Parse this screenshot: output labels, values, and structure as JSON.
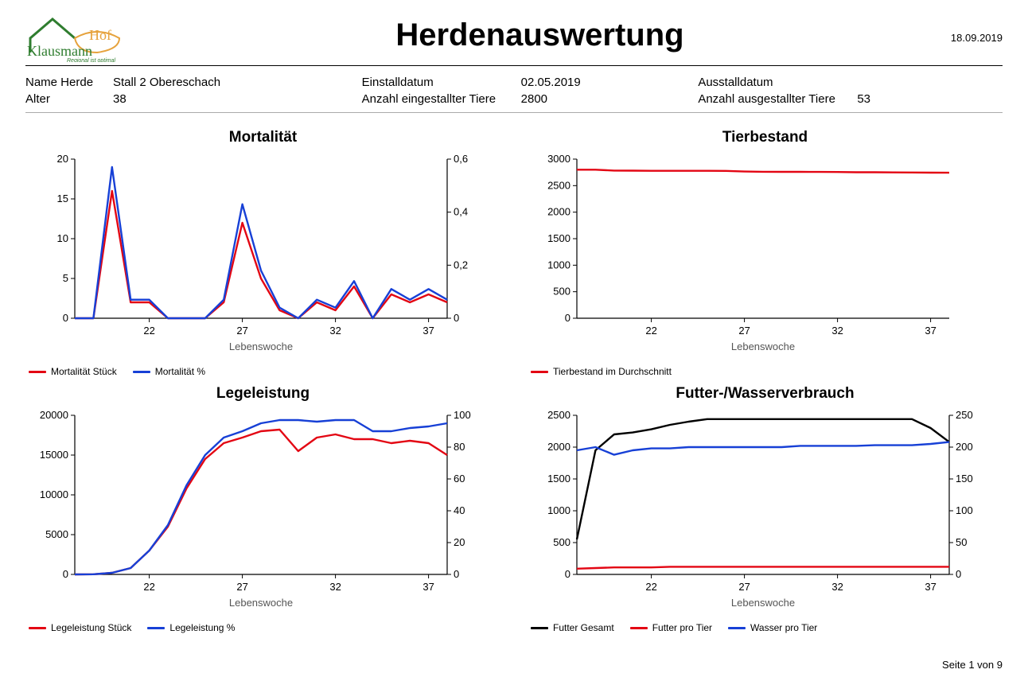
{
  "report": {
    "title": "Herdenauswertung",
    "date": "18.09.2019",
    "footer_prefix": "Seite",
    "footer_mid": "von",
    "page_cur": "1",
    "page_total": "9"
  },
  "meta": {
    "name_label": "Name Herde",
    "name_value": "Stall 2 Obereschach",
    "age_label": "Alter",
    "age_value": "38",
    "install_date_label": "Einstalldatum",
    "install_date_value": "02.05.2019",
    "installed_count_label": "Anzahl eingestallter Tiere",
    "installed_count_value": "2800",
    "uninstall_date_label": "Ausstalldatum",
    "uninstall_date_value": "",
    "uninstalled_count_label": "Anzahl ausgestallter Tiere",
    "uninstalled_count_value": "53"
  },
  "chart_data": [
    {
      "id": "mortality",
      "type": "line",
      "title": "Mortalität",
      "xlabel": "Lebenswoche",
      "x_start": 18,
      "x_ticks": [
        22,
        27,
        32,
        37
      ],
      "y_left_ticks": [
        0,
        5,
        10,
        15,
        20
      ],
      "y_right_ticks": [
        0,
        0.2,
        0.4,
        0.6
      ],
      "y_right_tick_labels": [
        "0",
        "0,2",
        "0,4",
        "0,6"
      ],
      "series": [
        {
          "name": "Mortalität Stück",
          "color": "#e30613",
          "axis": "left",
          "values": [
            0,
            0,
            16,
            2,
            2,
            0,
            0,
            0,
            2,
            12,
            5,
            1,
            0,
            2,
            1,
            4,
            0,
            3,
            2,
            3,
            2
          ]
        },
        {
          "name": "Mortalität %",
          "color": "#1740d6",
          "axis": "right",
          "values": [
            0,
            0,
            0.57,
            0.07,
            0.07,
            0,
            0,
            0,
            0.07,
            0.43,
            0.18,
            0.04,
            0,
            0.07,
            0.04,
            0.14,
            0,
            0.11,
            0.07,
            0.11,
            0.07
          ]
        }
      ]
    },
    {
      "id": "tierbestand",
      "type": "line",
      "title": "Tierbestand",
      "xlabel": "Lebenswoche",
      "x_start": 18,
      "x_ticks": [
        22,
        27,
        32,
        37
      ],
      "y_left_ticks": [
        0,
        500,
        1000,
        1500,
        2000,
        2500,
        3000
      ],
      "series": [
        {
          "name": "Tierbestand im Durchschnitt",
          "color": "#e30613",
          "axis": "left",
          "values": [
            2800,
            2800,
            2784,
            2782,
            2780,
            2780,
            2780,
            2780,
            2778,
            2766,
            2761,
            2760,
            2760,
            2758,
            2757,
            2753,
            2753,
            2750,
            2748,
            2745,
            2743
          ]
        }
      ]
    },
    {
      "id": "legeleistung",
      "type": "line",
      "title": "Legeleistung",
      "xlabel": "Lebenswoche",
      "x_start": 18,
      "x_ticks": [
        22,
        27,
        32,
        37
      ],
      "y_left_ticks": [
        0,
        5000,
        10000,
        15000,
        20000
      ],
      "y_right_ticks": [
        0,
        20,
        40,
        60,
        80,
        100
      ],
      "series": [
        {
          "name": "Legeleistung Stück",
          "color": "#e30613",
          "axis": "left",
          "values": [
            0,
            20,
            200,
            800,
            3000,
            6000,
            10800,
            14500,
            16500,
            17200,
            18000,
            18200,
            15500,
            17200,
            17600,
            17000,
            17000,
            16500,
            16800,
            16500,
            15000
          ]
        },
        {
          "name": "Legeleistung %",
          "color": "#1740d6",
          "axis": "right",
          "values": [
            0,
            0.1,
            1,
            4,
            15,
            31,
            56,
            75,
            86,
            90,
            95,
            97,
            97,
            96,
            97,
            97,
            90,
            90,
            92,
            93,
            95
          ]
        }
      ]
    },
    {
      "id": "futterwasser",
      "type": "line",
      "title": "Futter-/Wasserverbrauch",
      "xlabel": "Lebenswoche",
      "x_start": 18,
      "x_ticks": [
        22,
        27,
        32,
        37
      ],
      "y_left_ticks": [
        0,
        500,
        1000,
        1500,
        2000,
        2500
      ],
      "y_right_ticks": [
        0,
        50,
        100,
        150,
        200,
        250
      ],
      "series": [
        {
          "name": "Futter Gesamt",
          "color": "#000000",
          "axis": "left",
          "values": [
            550,
            1950,
            2200,
            2230,
            2280,
            2350,
            2400,
            2440,
            2440,
            2440,
            2440,
            2440,
            2440,
            2440,
            2440,
            2440,
            2440,
            2440,
            2440,
            2300,
            2080
          ]
        },
        {
          "name": "Futter pro Tier",
          "color": "#e30613",
          "axis": "right",
          "values": [
            9,
            10,
            11,
            11,
            11,
            12,
            12,
            12,
            12,
            12,
            12,
            12,
            12,
            12,
            12,
            12,
            12,
            12,
            12,
            12,
            12
          ]
        },
        {
          "name": "Wasser pro Tier",
          "color": "#1740d6",
          "axis": "right",
          "values": [
            195,
            200,
            188,
            195,
            198,
            198,
            200,
            200,
            200,
            200,
            200,
            200,
            202,
            202,
            202,
            202,
            203,
            203,
            203,
            205,
            208
          ]
        }
      ]
    }
  ]
}
